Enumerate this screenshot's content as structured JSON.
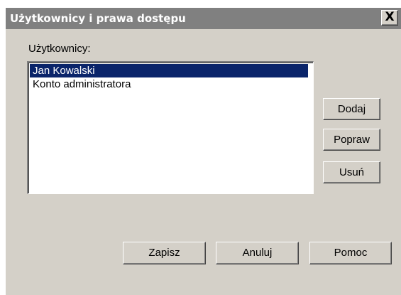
{
  "window": {
    "title": "Użytkownicy i prawa dostępu",
    "close_glyph": "X"
  },
  "users": {
    "label": "Użytkownicy:",
    "items": [
      {
        "name": "Jan Kowalski",
        "selected": true
      },
      {
        "name": "Konto administratora",
        "selected": false
      }
    ]
  },
  "side_buttons": {
    "add": "Dodaj",
    "edit": "Popraw",
    "delete": "Usuń"
  },
  "footer_buttons": {
    "save": "Zapisz",
    "cancel": "Anuluj",
    "help": "Pomoc"
  },
  "colors": {
    "titlebar": "#808080",
    "dialog_bg": "#d4d0c8",
    "selection": "#0a246a"
  }
}
